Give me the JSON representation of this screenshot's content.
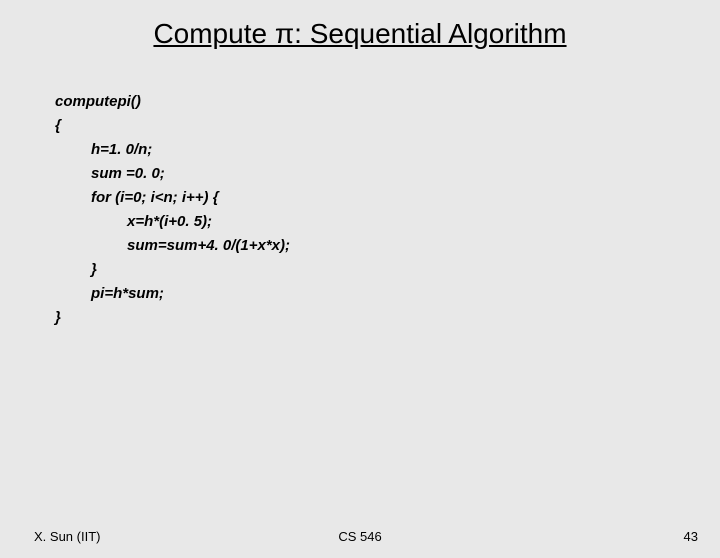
{
  "title": "Compute π: Sequential Algorithm",
  "code": {
    "l1": "computepi()",
    "l2": "{",
    "l3": "h=1. 0/n;",
    "l4": "sum =0. 0;",
    "l5": "for (i=0; i<n; i++) {",
    "l6": "x=h*(i+0. 5);",
    "l7": "sum=sum+4. 0/(1+x*x);",
    "l8": "}",
    "l9": "pi=h*sum;",
    "l10": "}"
  },
  "footer": {
    "left": "X. Sun (IIT)",
    "center": "CS 546",
    "right": "43"
  }
}
